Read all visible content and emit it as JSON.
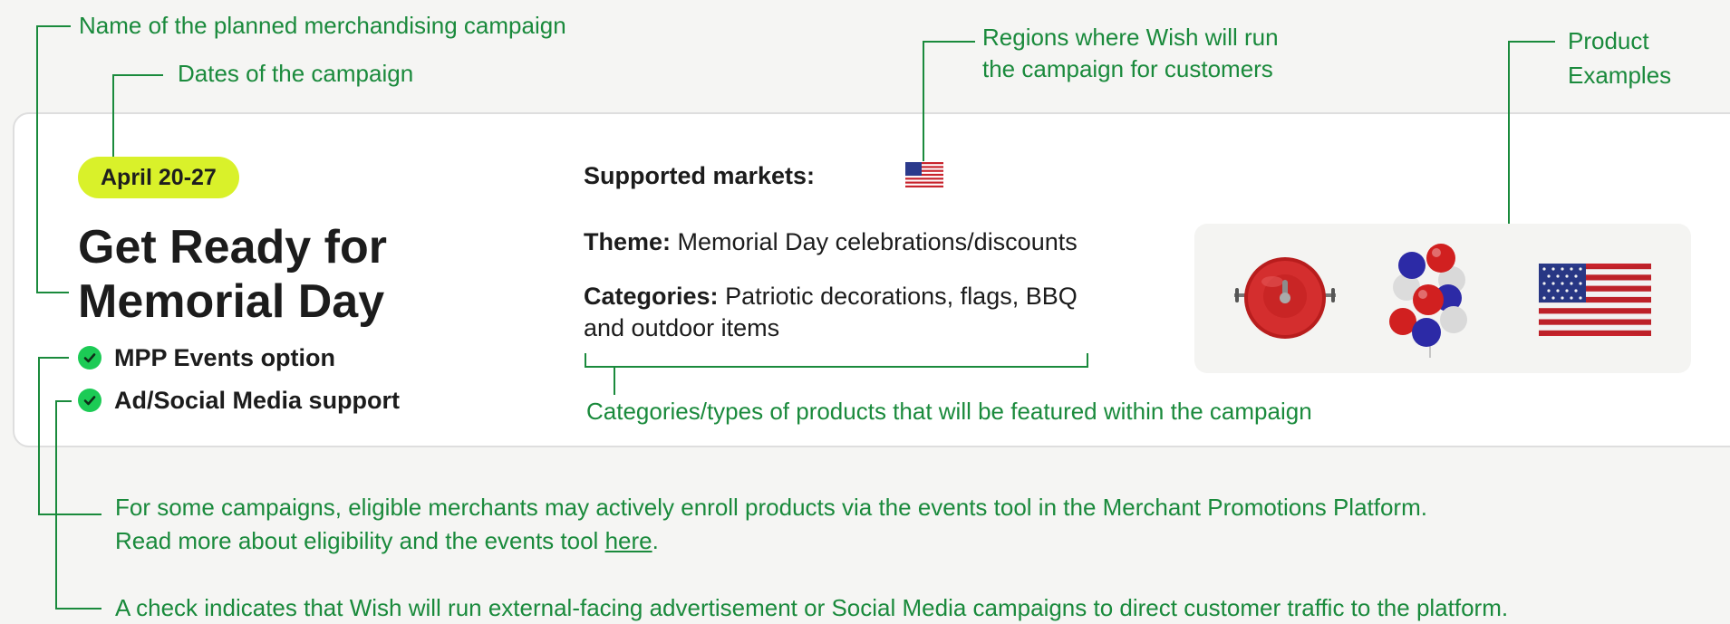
{
  "campaign": {
    "date_badge": "April 20-27",
    "title_line1": "Get Ready for",
    "title_line2": "Memorial Day",
    "features": [
      "MPP Events option",
      "Ad/Social Media support"
    ],
    "markets_label": "Supported markets:",
    "theme_label": "Theme:",
    "theme_value": "Memorial Day celebrations/discounts",
    "categories_label": "Categories:",
    "categories_value_line1": "Patriotic decorations, flags, BBQ",
    "categories_value_line2": "and outdoor items",
    "market_flags": [
      "us-flag-icon"
    ],
    "products": [
      "bbq-grill",
      "patriotic-balloons",
      "american-flag"
    ]
  },
  "annotations": {
    "campaign_name": "Name of the planned merchandising campaign",
    "dates": "Dates of the campaign",
    "regions_line1": "Regions where Wish will run",
    "regions_line2": "the campaign for customers",
    "product_examples_line1": "Product",
    "product_examples_line2": "Examples",
    "categories": "Categories/types of products that will be featured within the campaign",
    "events_line1": "For some campaigns, eligible merchants may actively enroll products via the events tool in the Merchant Promotions Platform.",
    "events_line2_prefix": "Read more about eligibility and the events tool ",
    "events_link": "here",
    "events_line2_suffix": ".",
    "ads": "A check indicates that Wish will run external-facing advertisement or Social Media campaigns to direct customer traffic to the platform."
  },
  "colors": {
    "annotation_green": "#1a8a3c",
    "badge_lime": "#d9f12a",
    "check_green": "#1ccb55",
    "card_background": "#ffffff",
    "page_background": "#f5f5f3"
  }
}
